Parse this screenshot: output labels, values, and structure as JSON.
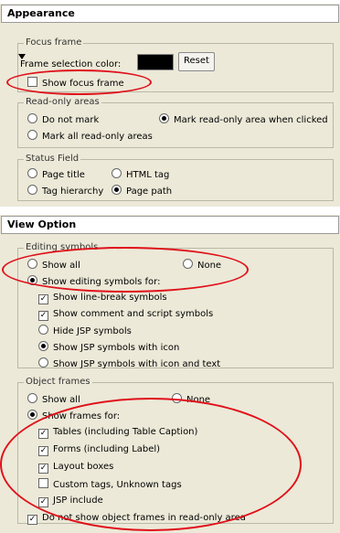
{
  "appearance": {
    "title": "Appearance",
    "focus_frame": {
      "title": "Focus frame",
      "color_label": "Frame selection color:",
      "color_value": "#000000",
      "reset_label": "Reset",
      "show_focus_label": "Show focus frame",
      "show_focus_checked": false
    },
    "read_only": {
      "title": "Read-only areas",
      "do_not_mark": "Do not mark",
      "mark_when_clicked": "Mark read-only area when clicked",
      "mark_all": "Mark all read-only areas",
      "selected": "mark_when_clicked"
    },
    "status_field": {
      "title": "Status Field",
      "page_title": "Page title",
      "html_tag": "HTML tag",
      "tag_hierarchy": "Tag hierarchy",
      "page_path": "Page path",
      "selected": "page_path"
    }
  },
  "view_option": {
    "title": "View Option",
    "editing_symbols": {
      "title": "Editing symbols",
      "show_all": "Show all",
      "none": "None",
      "show_for": "Show editing symbols for:",
      "selected": "show_for",
      "line_break": "Show line-break symbols",
      "comment_script": "Show comment and script symbols",
      "hide_jsp": "Hide JSP symbols",
      "jsp_icon": "Show JSP symbols with icon",
      "jsp_icon_text": "Show JSP symbols with icon and text",
      "jsp_selected": "jsp_icon"
    },
    "object_frames": {
      "title": "Object frames",
      "show_all": "Show all",
      "none": "None",
      "show_for": "Show frames for:",
      "selected": "show_for",
      "tables": "Tables (including Table Caption)",
      "forms": "Forms (including Label)",
      "layout_boxes": "Layout boxes",
      "custom_tags": "Custom tags, Unknown tags",
      "jsp_include": "JSP include",
      "read_only_frames": "Do not show object frames in read-only area"
    }
  },
  "annotation_color": "#e0101a"
}
